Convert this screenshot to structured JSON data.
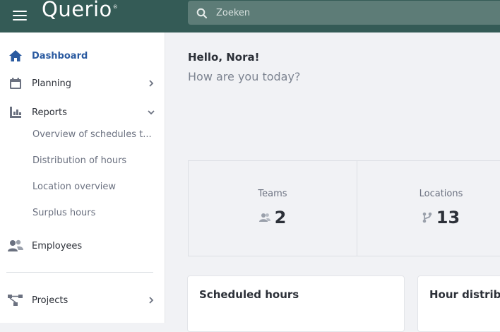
{
  "header": {
    "logo": "Querio",
    "logo_mark": "®",
    "search": {
      "placeholder": "Zoeken",
      "value": ""
    }
  },
  "sidebar": {
    "items": [
      {
        "label": "Dashboard",
        "icon": "home-icon",
        "active": true
      },
      {
        "label": "Planning",
        "icon": "calendar-icon",
        "chevron": "right"
      },
      {
        "label": "Reports",
        "icon": "reports-icon",
        "chevron": "down"
      },
      {
        "label": "Employees",
        "icon": "employees-icon"
      },
      {
        "label": "Projects",
        "icon": "projects-icon",
        "chevron": "right"
      }
    ],
    "report_subitems": [
      "Overview of schedules t...",
      "Distribution of hours",
      "Location overview",
      "Surplus hours"
    ]
  },
  "main": {
    "greeting": "Hello, Nora!",
    "subgreeting": "How are you today?",
    "stats": [
      {
        "title": "Teams",
        "value": "2",
        "icon": "team-icon"
      },
      {
        "title": "Locations",
        "value": "13",
        "icon": "location-branch-icon"
      }
    ],
    "cards": [
      {
        "title": "Scheduled hours"
      },
      {
        "title": "Hour distribut"
      }
    ]
  },
  "colors": {
    "topbar": "#345b56",
    "search_bg": "#5d7c77",
    "active_link": "#2a5aa0",
    "icon_gray": "#6b7180",
    "page_bg": "#f1f2f5"
  }
}
